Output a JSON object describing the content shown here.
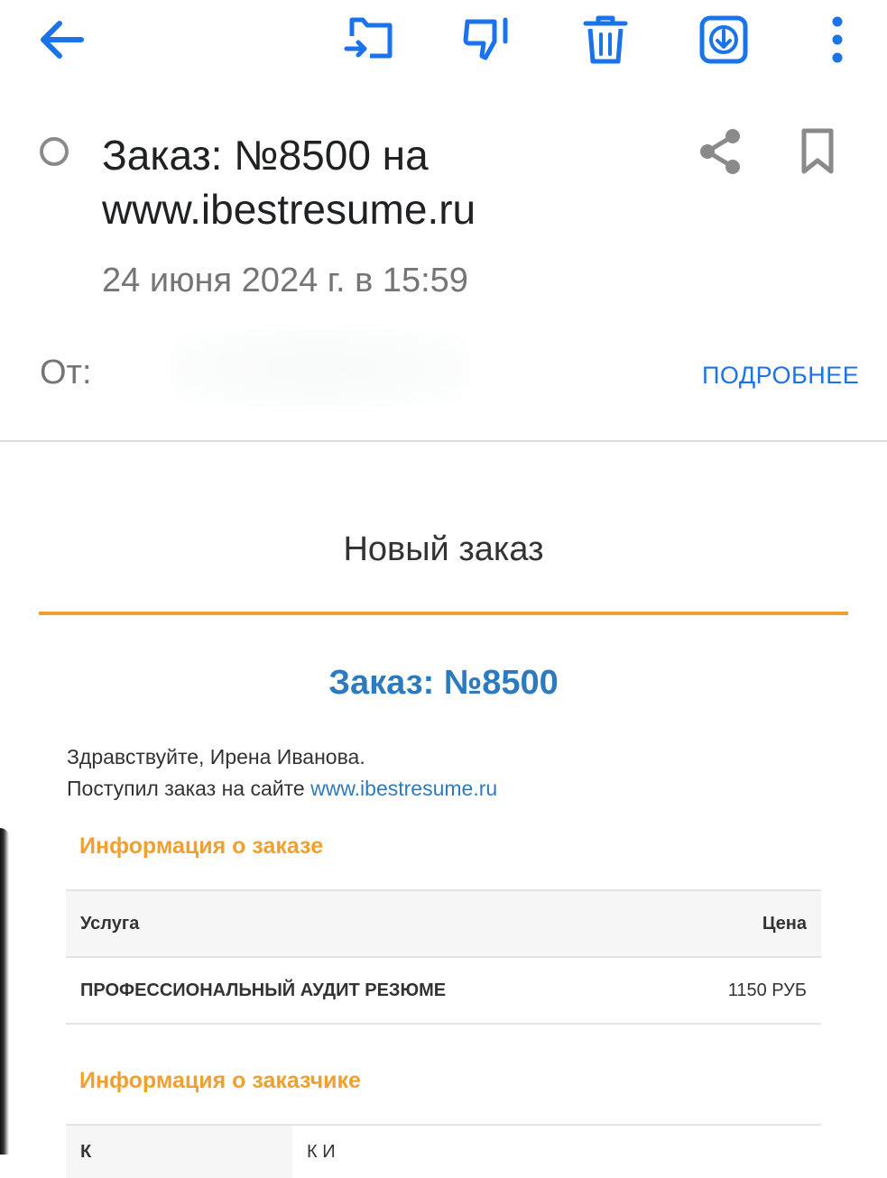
{
  "toolbar": {
    "back": "back-arrow-icon",
    "move": "move-to-folder-icon",
    "spam": "thumbs-down-icon",
    "delete": "trash-icon",
    "download": "download-icon",
    "more": "more-vert-icon"
  },
  "message": {
    "subject_line1": "Заказ: №8500 на",
    "subject_line2": "www.ibestresume.ru",
    "date": "24 июня 2024 г. в 15:59",
    "from_label": "От:",
    "details_link": "ПОДРОБНЕЕ"
  },
  "email": {
    "heading": "Новый заказ",
    "order_title": "Заказ: №8500",
    "greeting_line": "Здравствуйте, Ирена Иванова.",
    "received_prefix": "Поступил заказ на сайте ",
    "site_link": "www.ibestresume.ru",
    "order_info_title": "Информация о заказе",
    "order_table": {
      "headers": [
        "Услуга",
        "Цена"
      ],
      "rows": [
        [
          "ПРОФЕССИОНАЛЬНЫЙ АУДИТ РЕЗЮМЕ",
          "1150 РУБ"
        ]
      ]
    },
    "customer_info_title": "Информация о заказчике",
    "customer_row_label": "К",
    "customer_row_value": "К        И"
  },
  "colors": {
    "accent_blue": "#1a73e8",
    "link_blue": "#2d7bbf",
    "orange": "#f0a030",
    "icon_gray": "#8a8a8a"
  }
}
